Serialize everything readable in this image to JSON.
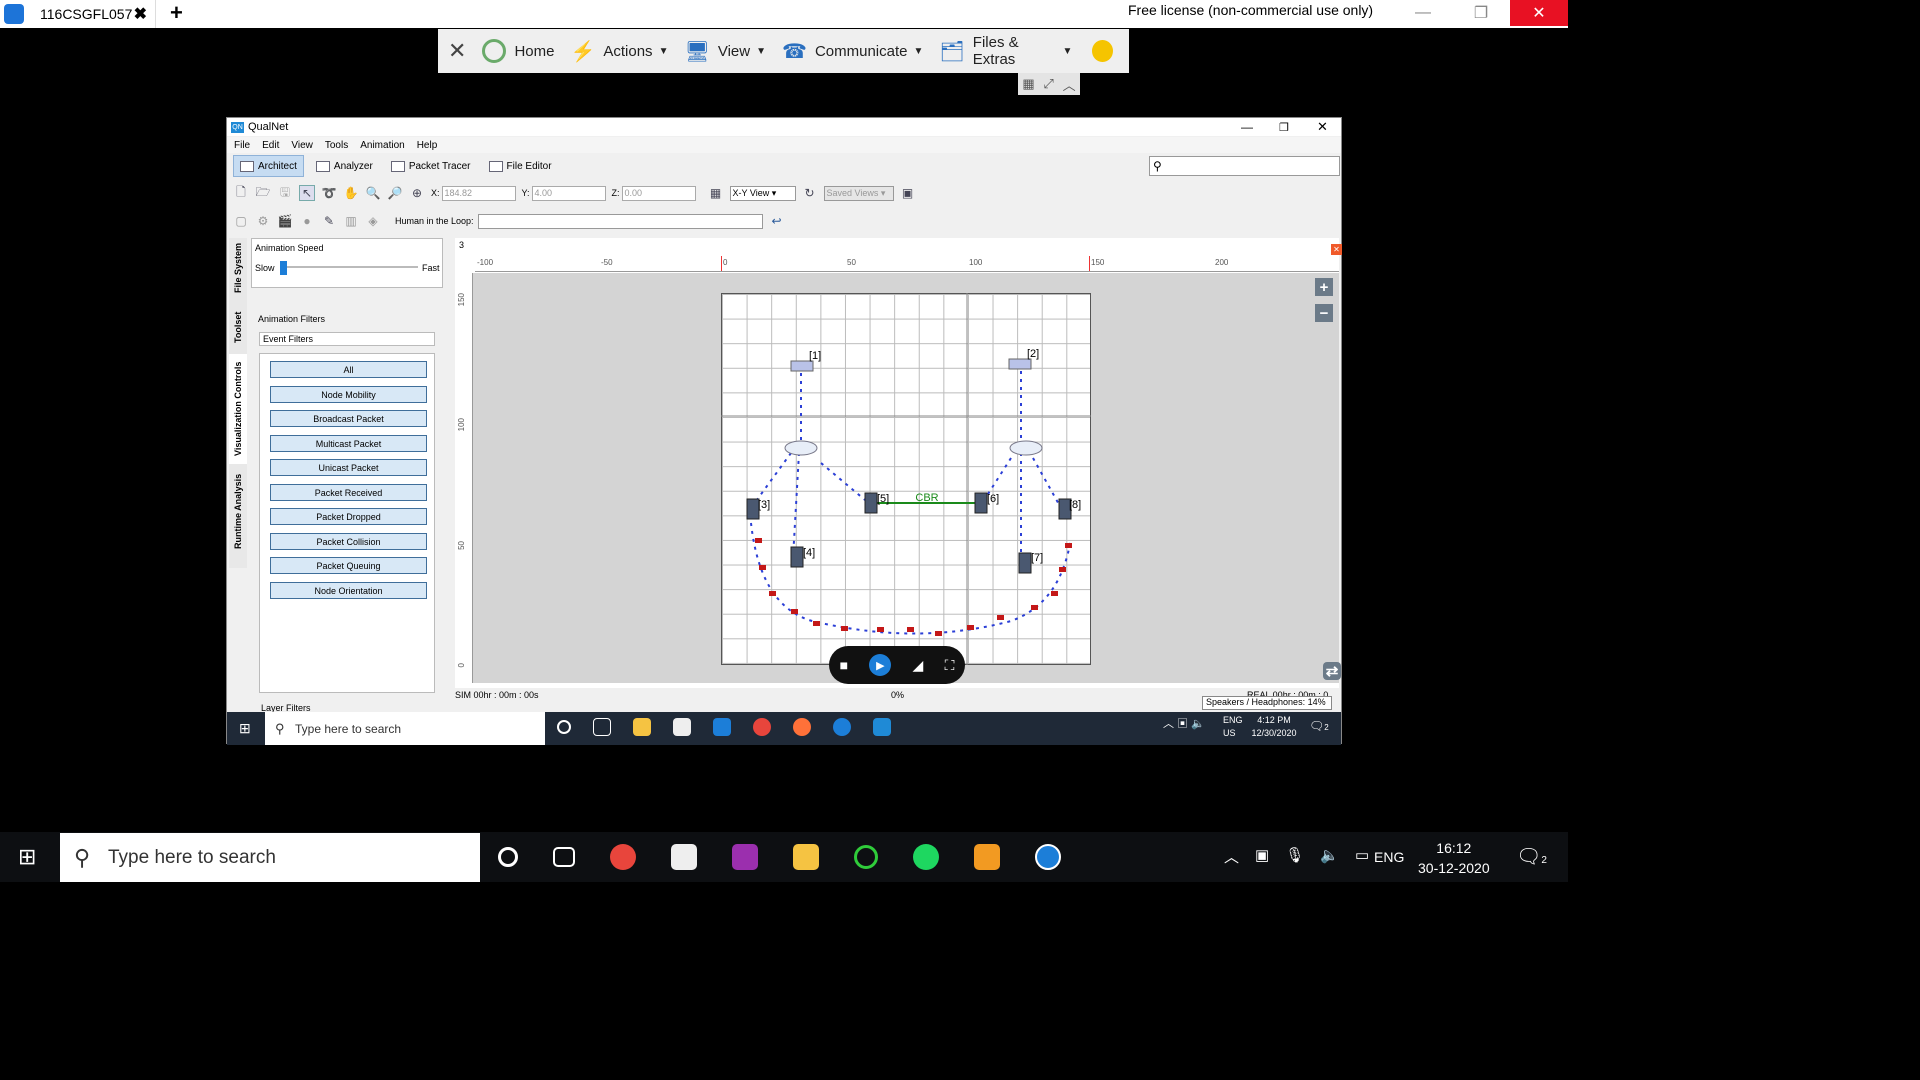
{
  "teamviewer": {
    "tab_title": "116CSGFL057",
    "tab_close": "✖",
    "new_tab": "+",
    "license": "Free license (non-commercial use only)",
    "toolbar": [
      {
        "label": "Home",
        "icon": "home-icon"
      },
      {
        "label": "Actions",
        "icon": "lightning-icon"
      },
      {
        "label": "View",
        "icon": "monitor-icon"
      },
      {
        "label": "Communicate",
        "icon": "phone-icon"
      },
      {
        "label": "Files & Extras",
        "icon": "files-icon"
      }
    ]
  },
  "qualnet": {
    "title": "QualNet",
    "logo": "QN",
    "menu": [
      "File",
      "Edit",
      "View",
      "Tools",
      "Animation",
      "Help"
    ],
    "tabs": [
      "Architect",
      "Analyzer",
      "Packet Tracer",
      "File Editor"
    ],
    "coords": {
      "x_label": "X:",
      "x": "184.82",
      "y_label": "Y:",
      "y": "4.00",
      "z_label": "Z:",
      "z": "0.00"
    },
    "view_select": "X-Y View",
    "saved_views": "Saved Views",
    "hitl_label": "Human in the Loop:",
    "side_tabs": [
      "File System",
      "Toolset",
      "Visualization Controls",
      "Runtime Analysis"
    ],
    "anim_speed": {
      "title": "Animation Speed",
      "slow": "Slow",
      "fast": "Fast"
    },
    "anim_filters": "Animation Filters",
    "event_filters": "Event Filters",
    "filter_buttons": [
      "All",
      "Node Mobility",
      "Broadcast Packet",
      "Multicast Packet",
      "Unicast Packet",
      "Packet Received",
      "Packet Dropped",
      "Packet Collision",
      "Packet Queuing",
      "Node Orientation"
    ],
    "layer_filters": "Layer Filters",
    "canvas_tab": "3",
    "ruler_x": [
      "-100",
      "-50",
      "0",
      "50",
      "100",
      "150",
      "200"
    ],
    "ruler_y": [
      "150",
      "100",
      "50",
      "0"
    ],
    "nodes": [
      "[1]",
      "[2]",
      "[3]",
      "[4]",
      "[5]",
      "[6]",
      "[7]",
      "[8]"
    ],
    "link_label": "CBR",
    "sim_time": "SIM 00hr : 00m : 00s",
    "progress": "0%",
    "real_time": "REAL 00hr : 00m : 0",
    "speakers": "Speakers / Headphones: 14%"
  },
  "inner_taskbar": {
    "search": "Type here to search",
    "lang": "ENG",
    "region": "US",
    "time": "4:12 PM",
    "date": "12/30/2020",
    "notif": "2"
  },
  "outer_taskbar": {
    "search": "Type here to search",
    "lang": "ENG",
    "time": "16:12",
    "date": "30-12-2020",
    "notif": "2"
  }
}
